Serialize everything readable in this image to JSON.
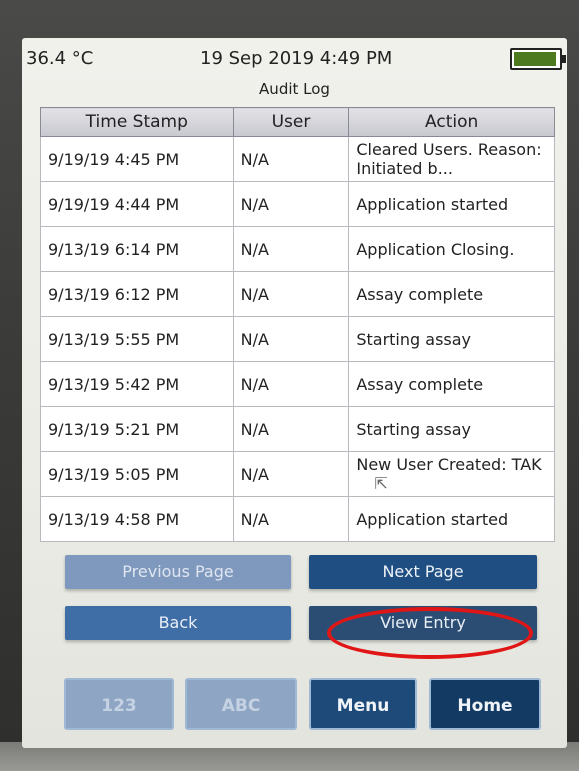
{
  "status": {
    "temperature": "36.4 °C",
    "datetime": "19 Sep 2019 4:49 PM",
    "battery_level": 0.95,
    "battery_color": "#4d7a1e"
  },
  "screen_title": "Audit Log",
  "table": {
    "headers": [
      "Time Stamp",
      "User",
      "Action"
    ],
    "rows": [
      {
        "timestamp": "9/19/19 4:45 PM",
        "user": "N/A",
        "action": "Cleared Users. Reason: Initiated b..."
      },
      {
        "timestamp": "9/19/19 4:44 PM",
        "user": "N/A",
        "action": "Application started"
      },
      {
        "timestamp": "9/13/19 6:14 PM",
        "user": "N/A",
        "action": "Application Closing."
      },
      {
        "timestamp": "9/13/19 6:12 PM",
        "user": "N/A",
        "action": "Assay complete"
      },
      {
        "timestamp": "9/13/19 5:55 PM",
        "user": "N/A",
        "action": "Starting assay"
      },
      {
        "timestamp": "9/13/19 5:42 PM",
        "user": "N/A",
        "action": "Assay complete"
      },
      {
        "timestamp": "9/13/19 5:21 PM",
        "user": "N/A",
        "action": "Starting assay"
      },
      {
        "timestamp": "9/13/19 5:05 PM",
        "user": "N/A",
        "action": "New User Created: TAK"
      },
      {
        "timestamp": "9/13/19 4:58 PM",
        "user": "N/A",
        "action": "Application started"
      }
    ]
  },
  "buttons": {
    "previous_page": "Previous Page",
    "next_page": "Next Page",
    "back": "Back",
    "view_entry": "View Entry"
  },
  "nav": {
    "numeric": "123",
    "alpha": "ABC",
    "menu": "Menu",
    "home": "Home"
  },
  "highlight_color": "#e01616"
}
